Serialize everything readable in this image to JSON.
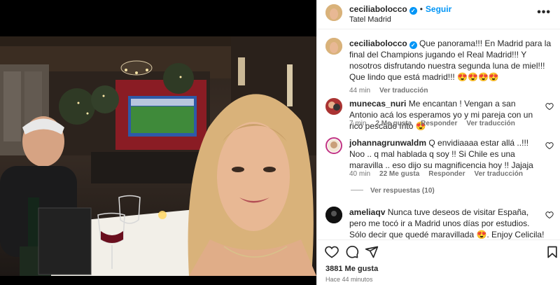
{
  "header": {
    "username": "ceciliabolocco",
    "follow_label": "Seguir",
    "location": "Tatel Madrid",
    "more_glyph": "•••"
  },
  "caption": {
    "username": "ceciliabolocco",
    "text": "Que panorama!!! En Madrid para la final del Champions jugando el Real Madrid!!! Y nosotros disfrutando nuestra segunda luna de miel!!! Que lindo que está madrid!!! 😍😍😍😍",
    "time": "44 min",
    "translate": "Ver traducción"
  },
  "comments": [
    {
      "username": "munecas_nuri",
      "text": "Me encantan ! Vengan a san Antonio acá los esperamos yo y mi pareja con un rico pescado frito 😍",
      "time": "7 min",
      "likes": "2 Me gusta",
      "reply": "Responder",
      "translate": "Ver traducción"
    },
    {
      "username": "johannagrunwaldm",
      "text": "Q envidiaaaa estar allá ..!!! Noo .. q mal hablada q soy !! Si Chile es una maravilla .. eso dijo su magnificencia hoy !! Jajaja",
      "time": "40 min",
      "likes": "22 Me gusta",
      "reply": "Responder",
      "translate": "Ver traducción",
      "replies_label": "Ver respuestas (10)"
    },
    {
      "username": "ameliaqv",
      "text": "Nunca tuve deseos de visitar España, pero me tocó ir a Madrid unos días por estudios. Sólo decir que quedé maravillada 😍. Enjoy Celicila! 🙌"
    }
  ],
  "footer": {
    "likes": "3881 Me gusta",
    "posted": "Hace 44 minutos"
  },
  "icons": [
    "heart-icon",
    "comment-icon",
    "share-icon",
    "bookmark-icon",
    "verified-icon",
    "more-icon"
  ],
  "colors": {
    "link": "#0095f6",
    "muted": "#737373",
    "text": "#262626"
  }
}
